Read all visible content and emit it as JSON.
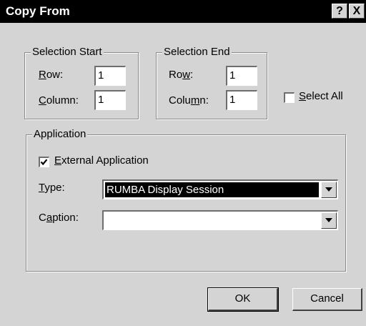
{
  "window": {
    "title": "Copy From",
    "help_button": "?",
    "close_button": "X"
  },
  "selection_start": {
    "legend": "Selection Start",
    "row_label_key": "R",
    "row_label_rest": "ow:",
    "row_value": "1",
    "column_label_key": "C",
    "column_label_rest": "olumn:",
    "column_value": "1"
  },
  "selection_end": {
    "legend": "Selection End",
    "row_label_pre": "Ro",
    "row_label_key": "w",
    "row_label_rest": ":",
    "row_value": "1",
    "column_label_pre": "Colu",
    "column_label_key": "m",
    "column_label_rest": "n:",
    "column_value": "1"
  },
  "select_all": {
    "label_key": "S",
    "label_rest": "elect All",
    "checked": false
  },
  "application": {
    "legend": "Application",
    "external_key": "E",
    "external_rest": "xternal Application",
    "external_checked": true,
    "type_key": "T",
    "type_rest": "ype:",
    "type_value": "RUMBA Display Session",
    "caption_pre": "C",
    "caption_key": "a",
    "caption_rest": "ption:",
    "caption_value": ""
  },
  "buttons": {
    "ok": "OK",
    "cancel": "Cancel"
  }
}
